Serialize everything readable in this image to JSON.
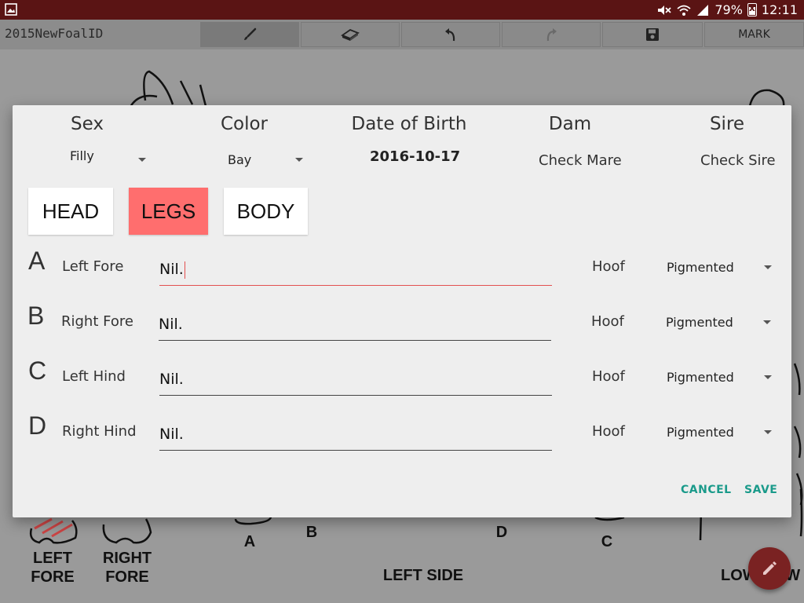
{
  "status_bar": {
    "battery": "79%",
    "time": "12:11"
  },
  "toolbar": {
    "title": "2015NewFoalID",
    "buttons": [
      {
        "icon": "brush-icon"
      },
      {
        "icon": "eraser-icon"
      },
      {
        "icon": "undo-icon"
      },
      {
        "icon": "redo-icon"
      },
      {
        "icon": "save-icon"
      },
      {
        "label": "MARK"
      }
    ]
  },
  "canvas": {
    "labels": {
      "left_fore": "LEFT\nFORE",
      "right_fore": "RIGHT\nFORE",
      "a": "A",
      "b": "B",
      "d": "D",
      "c": "C",
      "left_side": "LEFT SIDE",
      "partial": "LOW   IEW"
    }
  },
  "dialog": {
    "headers": {
      "sex": "Sex",
      "color": "Color",
      "dob": "Date of Birth",
      "dam": "Dam",
      "sire": "Sire"
    },
    "values": {
      "sex": "Filly",
      "color": "Bay",
      "dob": "2016-10-17",
      "dam": "Check Mare",
      "sire": "Check Sire"
    },
    "tabs": [
      {
        "label": "HEAD",
        "active": false
      },
      {
        "label": "LEGS",
        "active": true
      },
      {
        "label": "BODY",
        "active": false
      }
    ],
    "legs": [
      {
        "letter": "A",
        "name": "Left Fore",
        "value": "Nil.",
        "hoof_label": "Hoof",
        "hoof": "Pigmented"
      },
      {
        "letter": "B",
        "name": "Right Fore",
        "value": "Nil.",
        "hoof_label": "Hoof",
        "hoof": "Pigmented"
      },
      {
        "letter": "C",
        "name": "Left Hind",
        "value": "Nil.",
        "hoof_label": "Hoof",
        "hoof": "Pigmented"
      },
      {
        "letter": "D",
        "name": "Right Hind",
        "value": "Nil.",
        "hoof_label": "Hoof",
        "hoof": "Pigmented"
      }
    ],
    "cancel": "CANCEL",
    "save": "SAVE"
  },
  "colors": {
    "accent": "#ff6e6e",
    "teal": "#1a9a8a",
    "statusbar": "#5a1414"
  }
}
